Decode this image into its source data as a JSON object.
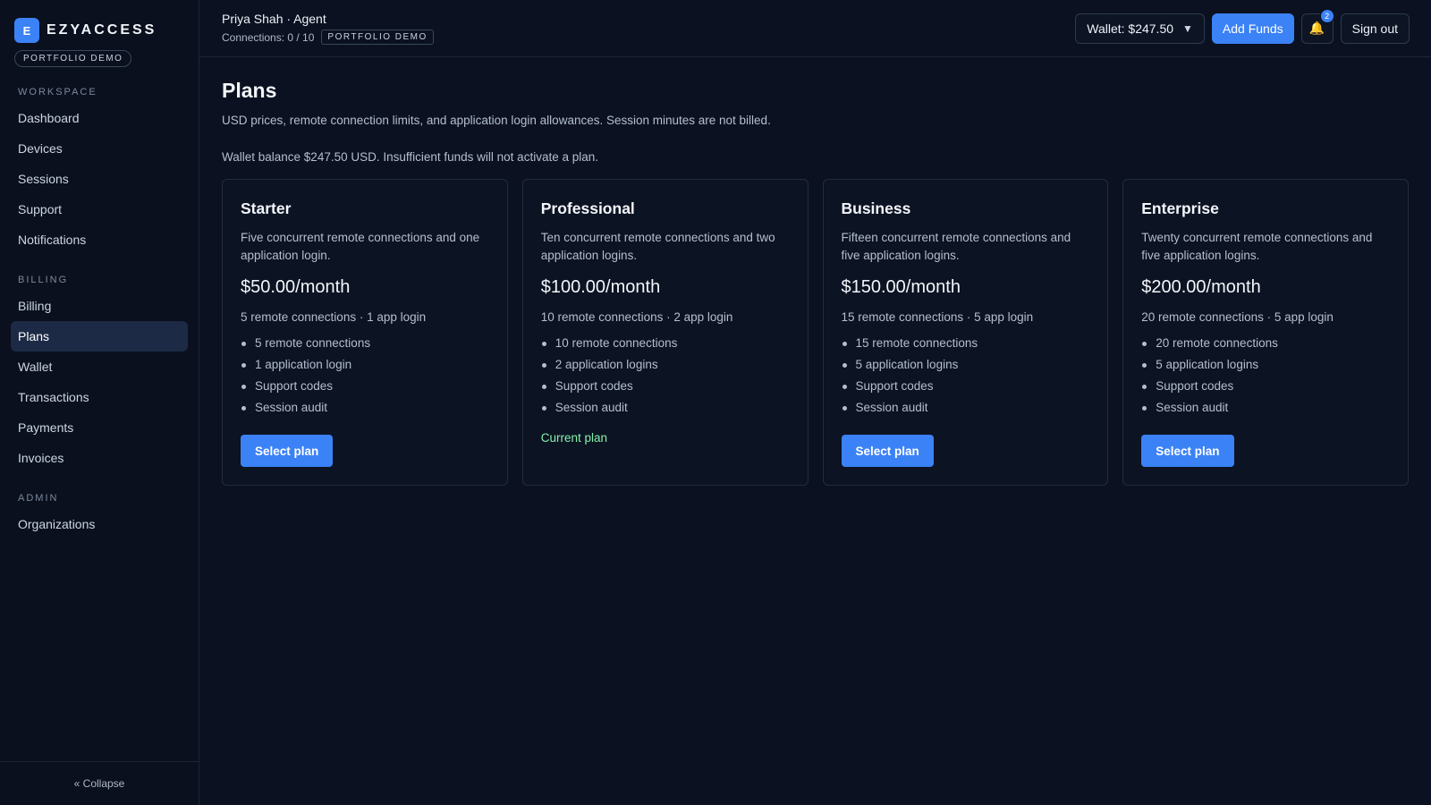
{
  "brand": {
    "logo_letter": "E",
    "name": "EZYACCESS",
    "pill": "PORTFOLIO DEMO"
  },
  "sidebar": {
    "sections": [
      {
        "title": "WORKSPACE",
        "items": [
          "Dashboard",
          "Devices",
          "Sessions",
          "Support",
          "Notifications"
        ]
      },
      {
        "title": "BILLING",
        "items": [
          "Billing",
          "Plans",
          "Wallet",
          "Transactions",
          "Payments",
          "Invoices"
        ]
      },
      {
        "title": "ADMIN",
        "items": [
          "Organizations"
        ]
      }
    ],
    "active_item": "Plans",
    "collapse_label": "« Collapse"
  },
  "header": {
    "user": "Priya Shah · Agent",
    "connections": "Connections: 0 / 10",
    "demo_tag": "PORTFOLIO DEMO",
    "wallet_label": "Wallet: $247.50",
    "caret": "▼",
    "add_funds": "Add Funds",
    "notification_count": "2",
    "bell_icon": "🔔",
    "sign_out": "Sign out"
  },
  "page": {
    "title": "Plans",
    "subtitle": "USD prices, remote connection limits, and application login allowances. Session minutes are not billed.",
    "wallet_note": "Wallet balance $247.50 USD. Insufficient funds will not activate a plan."
  },
  "plans": [
    {
      "name": "Starter",
      "description": "Five concurrent remote connections and one application login.",
      "price": "$50.00/month",
      "summary": "5 remote connections · 1 app login",
      "features": [
        "5 remote connections",
        "1 application login",
        "Support codes",
        "Session audit"
      ],
      "action": "Select plan",
      "current": false
    },
    {
      "name": "Professional",
      "description": "Ten concurrent remote connections and two application logins.",
      "price": "$100.00/month",
      "summary": "10 remote connections · 2 app login",
      "features": [
        "10 remote connections",
        "2 application logins",
        "Support codes",
        "Session audit"
      ],
      "action": "Current plan",
      "current": true
    },
    {
      "name": "Business",
      "description": "Fifteen concurrent remote connections and five application logins.",
      "price": "$150.00/month",
      "summary": "15 remote connections · 5 app login",
      "features": [
        "15 remote connections",
        "5 application logins",
        "Support codes",
        "Session audit"
      ],
      "action": "Select plan",
      "current": false
    },
    {
      "name": "Enterprise",
      "description": "Twenty concurrent remote connections and five application logins.",
      "price": "$200.00/month",
      "summary": "20 remote connections · 5 app login",
      "features": [
        "20 remote connections",
        "5 application logins",
        "Support codes",
        "Session audit"
      ],
      "action": "Select plan",
      "current": false
    }
  ],
  "colors": {
    "background": "#0b1120",
    "accent": "#3b82f6",
    "active_nav": "#1c2a45",
    "current_plan_text": "#86efac"
  }
}
